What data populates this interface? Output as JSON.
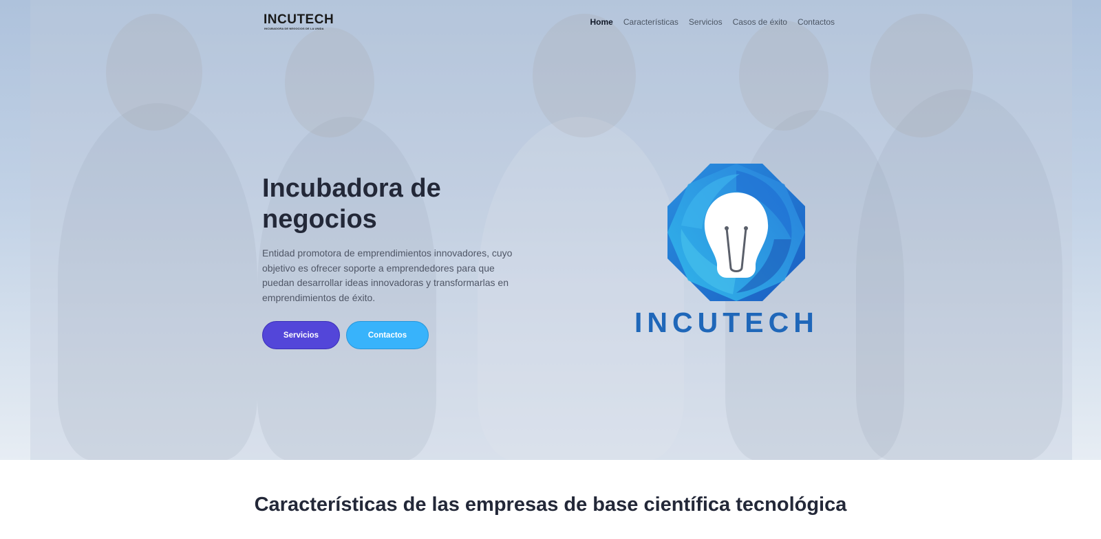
{
  "nav": {
    "logo_text": "INCUTECH",
    "logo_tagline": "INCUBADORA DE NEGOCIOS DE LA UNIDA",
    "items": [
      {
        "label": "Home",
        "active": true
      },
      {
        "label": "Características",
        "active": false
      },
      {
        "label": "Servicios",
        "active": false
      },
      {
        "label": "Casos de éxito",
        "active": false
      },
      {
        "label": "Contactos",
        "active": false
      }
    ]
  },
  "hero": {
    "title": "Incubadora de negocios",
    "description": "Entidad promotora de emprendimientos innovadores, cuyo objetivo es ofrecer soporte a emprendedores para que puedan desarrollar ideas innovadoras y transformarlas en emprendimientos de éxito.",
    "buttons": {
      "primary": "Servicios",
      "secondary": "Contactos"
    },
    "brand_name": "INCUTECH"
  },
  "section": {
    "title": "Características de las empresas de base científica tecnológica"
  },
  "colors": {
    "primary_button": "#5346d9",
    "secondary_button": "#38b3fb",
    "brand_blue": "#1f67b9",
    "heading": "#232838"
  },
  "icons": {
    "hero_logo": "lightbulb-icon"
  }
}
